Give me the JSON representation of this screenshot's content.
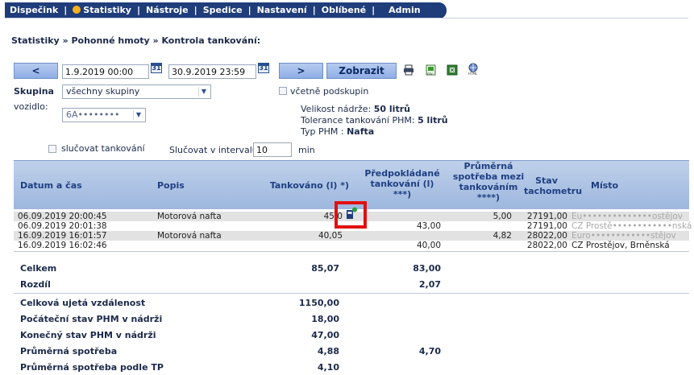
{
  "nav": {
    "items": [
      "Dispečink",
      "Statistiky",
      "Nástroje",
      "Spedice",
      "Nastavení",
      "Oblíbené",
      "Admin"
    ]
  },
  "breadcrumb": "Statistiky » Pohonné hmoty » Kontrola tankování:",
  "controls": {
    "prev_label": "<",
    "next_label": ">",
    "date_from": "1.9.2019 00:00",
    "date_to": "30.9.2019 23:59",
    "calendar_label": "31",
    "show_label": "Zobrazit",
    "group_label": "Skupina",
    "group_value": "všechny skupiny",
    "subgroups_label": "včetně podskupin",
    "vehicle_label": "vozidlo:",
    "vehicle_value": "6A••••••••",
    "merge_label": "slučovat tankování",
    "merge_interval_label": "Slučovat v intervalu",
    "merge_interval_value": "10",
    "merge_interval_unit": "min"
  },
  "vehicle_info": {
    "tank_label": "Velikost nádrže:",
    "tank_value": "50 litrů",
    "tolerance_label": "Tolerance tankování PHM:",
    "tolerance_value": "5 litrů",
    "fuel_label": "Typ PHM :",
    "fuel_value": "Nafta"
  },
  "table": {
    "headers": {
      "datetime": "Datum a čas",
      "description": "Popis",
      "refueled": "Tankováno (l) *)",
      "expected": "Předpokládané tankování (l) ***)",
      "avg_consumption": "Průměrná spotřeba mezi tankováním ****)",
      "odometer": "Stav tachometru",
      "place": "Místo"
    },
    "rows": [
      {
        "datetime": "06.09.2019 20:00:45",
        "description": "Motorová nafta",
        "refueled": "45,0",
        "expected": "",
        "avg": "5,00",
        "odometer": "27191,00",
        "place": "Eu••••••••••••••ostějov"
      },
      {
        "datetime": "06.09.2019 20:01:38",
        "description": "",
        "refueled": "",
        "expected": "43,00",
        "avg": "",
        "odometer": "27191,00",
        "place": "CZ Prostě••••••••••••nská"
      },
      {
        "datetime": "16.09.2019 16:01:57",
        "description": "Motorová nafta",
        "refueled": "40,05",
        "expected": "",
        "avg": "4,82",
        "odometer": "28022,00",
        "place": "Euro••••••••••••stějov"
      },
      {
        "datetime": "16.09.2019 16:02:46",
        "description": "",
        "refueled": "",
        "expected": "40,00",
        "avg": "",
        "odometer": "28022,00",
        "place": "CZ Prostějov, Brněnská"
      }
    ],
    "totals": [
      {
        "label": "Celkem",
        "refueled": "85,07",
        "expected": "83,00"
      },
      {
        "label": "Rozdíl",
        "refueled": "",
        "expected": "2,07"
      }
    ],
    "summary": [
      {
        "label": "Celková ujetá vzdálenost",
        "value": "1150,00",
        "extra": ""
      },
      {
        "label": "Počáteční stav PHM v nádrži",
        "value": "18,00",
        "extra": ""
      },
      {
        "label": "Konečný stav PHM v nádrži",
        "value": "47,00",
        "extra": ""
      },
      {
        "label": "Průměrná spotřeba",
        "value": "4,88",
        "extra": "4,70"
      },
      {
        "label": "Průměrná spotřeba podle TP",
        "value": "4,10",
        "extra": ""
      }
    ]
  },
  "colors": {
    "nav_bg": "#1f3d7a",
    "highlight_box": "#e01010",
    "header_text": "#1e3f82"
  },
  "icons": [
    "print-icon",
    "csv-export-icon",
    "excel-export-icon",
    "html-export-icon",
    "fuel-pump-icon"
  ]
}
